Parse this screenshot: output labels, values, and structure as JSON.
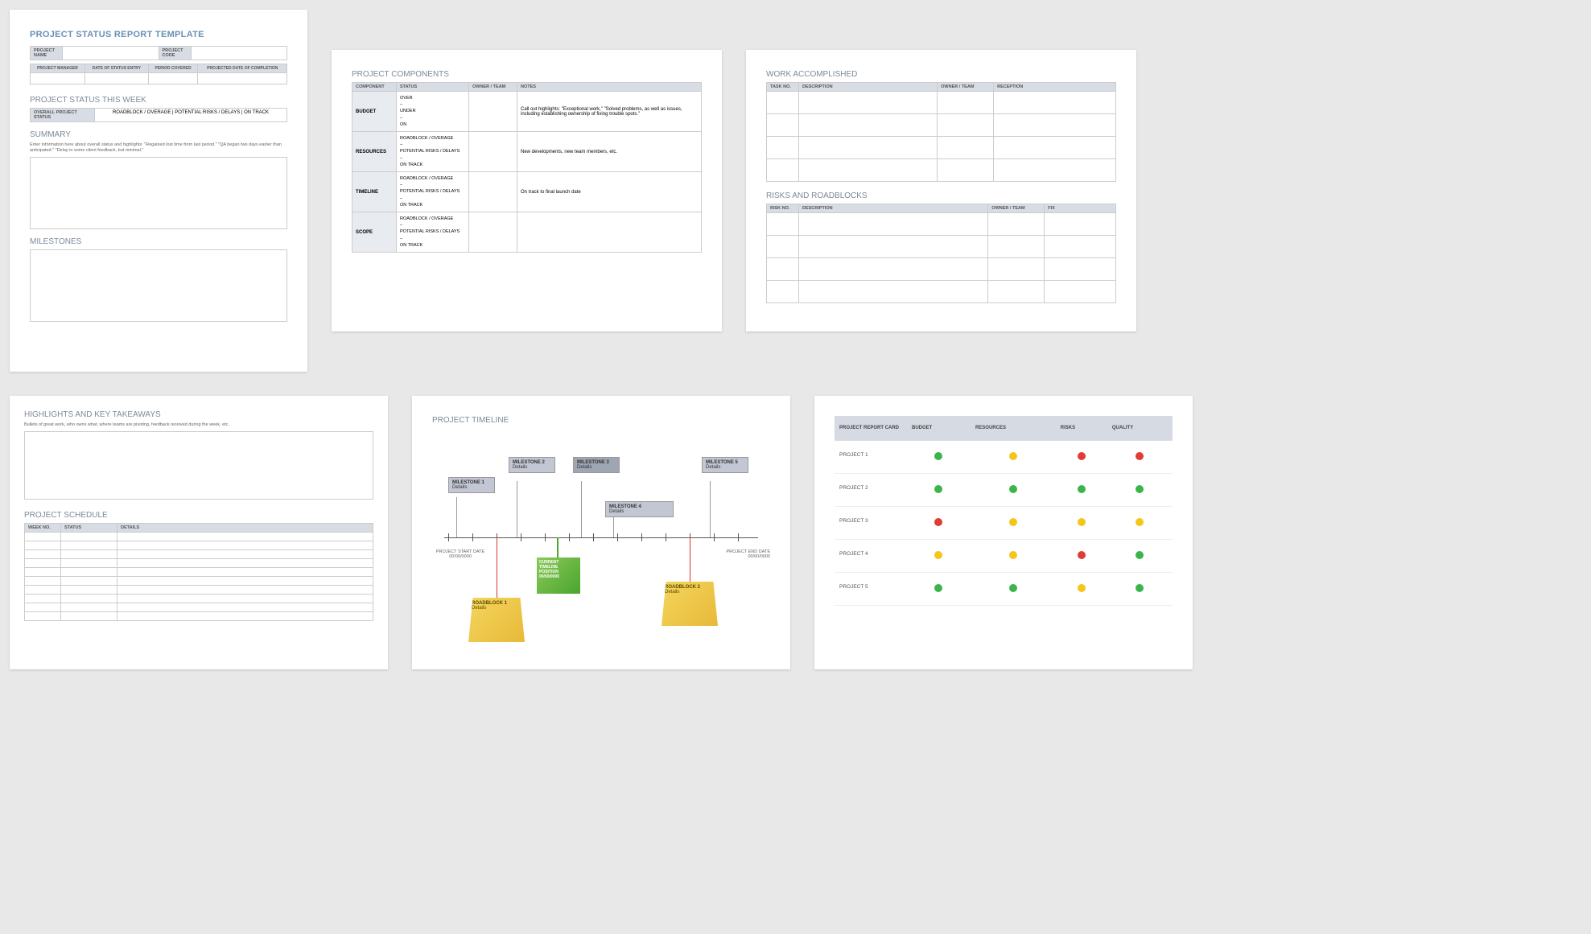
{
  "page1": {
    "title": "PROJECT STATUS REPORT TEMPLATE",
    "proj_name_lbl": "PROJECT NAME",
    "proj_code_lbl": "PROJECT CODE",
    "pm_lbl": "PROJECT MANAGER",
    "date_entry_lbl": "DATE OF STATUS ENTRY",
    "period_lbl": "PERIOD COVERED",
    "completion_lbl": "PROJECTED DATE OF COMPLETION",
    "week_title": "PROJECT STATUS THIS WEEK",
    "overall_lbl": "OVERALL PROJECT STATUS",
    "status_opts": "ROADBLOCK / OVERAGE   |   POTENTIAL RISKS / DELAYS   |   ON TRACK",
    "summary_lbl": "SUMMARY",
    "summary_hint": "Enter information here about overall status and highlights: \"Regained lost time from last period.\" \"QA began two days earlier than anticipated.\" \"Delay in some client feedback, but minimal.\"",
    "milestones_lbl": "MILESTONES"
  },
  "page2": {
    "title": "PROJECT COMPONENTS",
    "cols": {
      "c1": "COMPONENT",
      "c2": "STATUS",
      "c3": "OWNER / TEAM",
      "c4": "NOTES"
    },
    "rows": [
      {
        "name": "BUDGET",
        "status": "OVER\n–\nUNDER\n–\nON",
        "notes": "Call out highlights: \"Exceptional work,\" \"Solved problems, as well as issues, including establishing ownership of fixing trouble spots.\""
      },
      {
        "name": "RESOURCES",
        "status": "ROADBLOCK / OVERAGE\n–\nPOTENTIAL RISKS / DELAYS\n–\nON TRACK",
        "notes": "New developments, new team members, etc."
      },
      {
        "name": "TIMELINE",
        "status": "ROADBLOCK / OVERAGE\n–\nPOTENTIAL RISKS / DELAYS\n–\nON TRACK",
        "notes": "On track to final launch date"
      },
      {
        "name": "SCOPE",
        "status": "ROADBLOCK / OVERAGE\n–\nPOTENTIAL RISKS / DELAYS\n–\nON TRACK",
        "notes": ""
      }
    ]
  },
  "page3": {
    "work_title": "WORK ACCOMPLISHED",
    "work_cols": {
      "c1": "TASK NO.",
      "c2": "DESCRIPTION",
      "c3": "OWNER / TEAM",
      "c4": "RECEPTION"
    },
    "risk_title": "RISKS AND ROADBLOCKS",
    "risk_cols": {
      "c1": "RISK NO.",
      "c2": "DESCRIPTION",
      "c3": "OWNER / TEAM",
      "c4": "FIX"
    }
  },
  "page4": {
    "hl_title": "HIGHLIGHTS AND KEY TAKEAWAYS",
    "hl_hint": "Bullets of great work, who owns what, where teams are pivoting, feedback received during the week, etc.",
    "sched_title": "PROJECT SCHEDULE",
    "sched_cols": {
      "c1": "WEEK NO.",
      "c2": "STATUS",
      "c3": "DETAILS"
    }
  },
  "page5": {
    "title": "PROJECT TIMELINE",
    "start_lbl": "PROJECT START DATE",
    "start_date": "00/00/0000",
    "end_lbl": "PROJECT END DATE",
    "end_date": "00/00/0000",
    "ms": [
      {
        "t": "MILESTONE 1",
        "d": "Details"
      },
      {
        "t": "MILESTONE 2",
        "d": "Details"
      },
      {
        "t": "MILESTONE 3",
        "d": "Details"
      },
      {
        "t": "MILESTONE 4",
        "d": "Details"
      },
      {
        "t": "MILESTONE 5",
        "d": "Details"
      }
    ],
    "rb": [
      {
        "t": "ROADBLOCK 1",
        "d": "Details"
      },
      {
        "t": "ROADBLOCK 2",
        "d": "Details"
      }
    ],
    "current": "CURRENT TIMELINE POSITION 00/00/0000"
  },
  "page6": {
    "cols": {
      "c1": "PROJECT REPORT CARD",
      "c2": "BUDGET",
      "c3": "RESOURCES",
      "c4": "RISKS",
      "c5": "QUALITY"
    },
    "rows": [
      {
        "name": "PROJECT 1",
        "v": [
          "g",
          "y",
          "r",
          "r"
        ]
      },
      {
        "name": "PROJECT 2",
        "v": [
          "g",
          "g",
          "g",
          "g"
        ]
      },
      {
        "name": "PROJECT 3",
        "v": [
          "r",
          "y",
          "y",
          "y"
        ]
      },
      {
        "name": "PROJECT 4",
        "v": [
          "y",
          "y",
          "r",
          "g"
        ]
      },
      {
        "name": "PROJECT 5",
        "v": [
          "g",
          "g",
          "y",
          "g"
        ]
      }
    ]
  }
}
